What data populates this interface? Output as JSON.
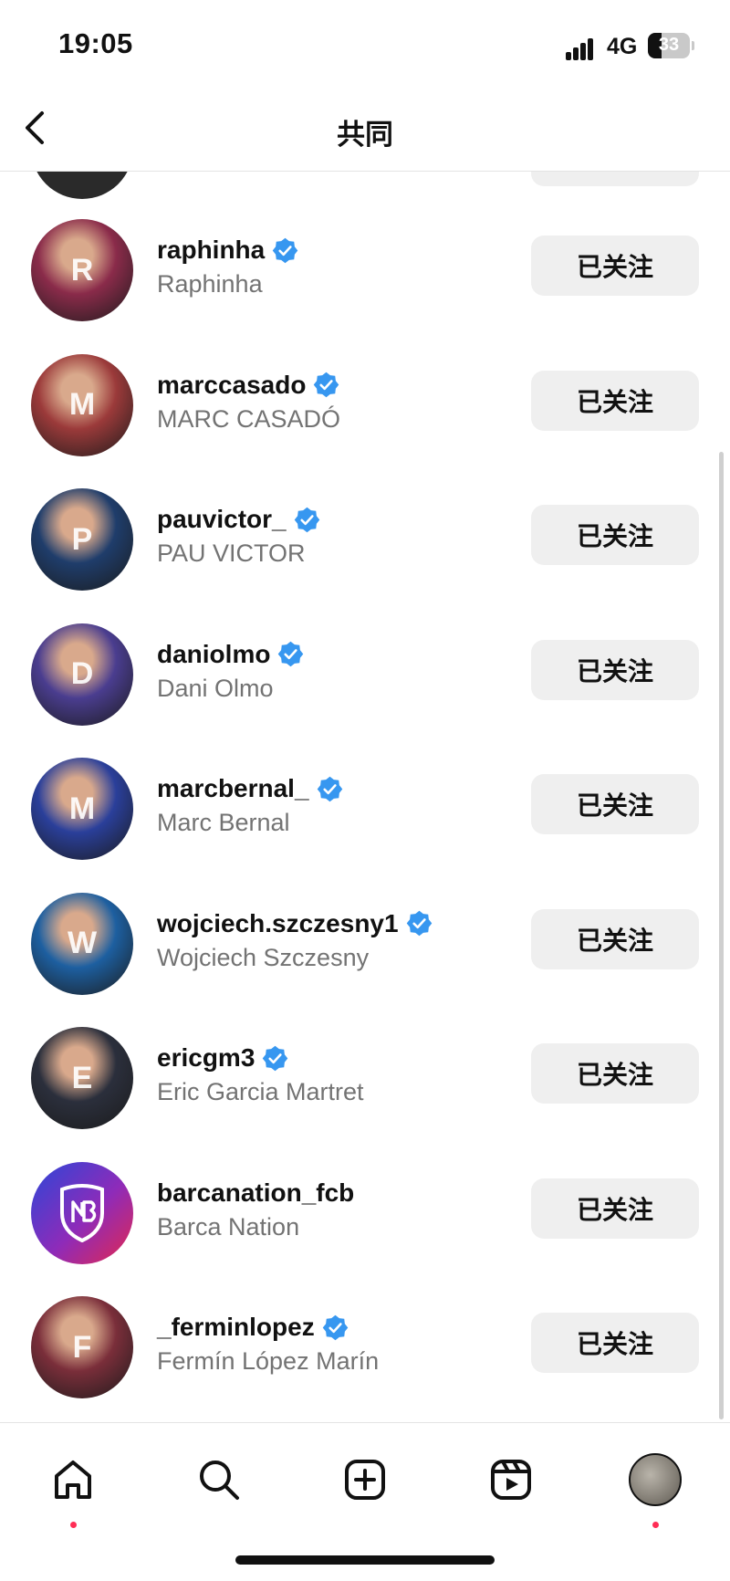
{
  "status_bar": {
    "time": "19:05",
    "network": "4G",
    "battery": "33",
    "battery_level": 0.33
  },
  "header": {
    "title": "共同"
  },
  "follow_label": "已关注",
  "users": [
    {
      "username": "raphinha",
      "full_name": "Raphinha",
      "verified": true,
      "avatar_color": "#8a2b4a",
      "initial": "R"
    },
    {
      "username": "marccasado",
      "full_name": "MARC CASADÓ",
      "verified": true,
      "avatar_color": "#9b3a3a",
      "initial": "M"
    },
    {
      "username": "pauvictor_",
      "full_name": "PAU VICTOR",
      "verified": true,
      "avatar_color": "#1f3d6b",
      "initial": "P"
    },
    {
      "username": "daniolmo",
      "full_name": "Dani Olmo",
      "verified": true,
      "avatar_color": "#4a3d8f",
      "initial": "D"
    },
    {
      "username": "marcbernal_",
      "full_name": "Marc Bernal",
      "verified": true,
      "avatar_color": "#2a3f9a",
      "initial": "M"
    },
    {
      "username": "wojciech.szczesny1",
      "full_name": "Wojciech Szczesny",
      "verified": true,
      "avatar_color": "#1d5fa0",
      "initial": "W"
    },
    {
      "username": "ericgm3",
      "full_name": "Eric Garcia Martret",
      "verified": true,
      "avatar_color": "#2b2f3c",
      "initial": "E"
    },
    {
      "username": "barcanation_fcb",
      "full_name": "Barca Nation",
      "verified": false,
      "avatar_color": "#5a34c7",
      "initial": ""
    },
    {
      "username": "_ferminlopez",
      "full_name": "Fermín López Marín",
      "verified": true,
      "avatar_color": "#7a2e3a",
      "initial": "F"
    }
  ],
  "tab_bar": {
    "items": [
      {
        "name": "home-icon",
        "notification_dot": true
      },
      {
        "name": "search-icon",
        "notification_dot": false
      },
      {
        "name": "create-icon",
        "notification_dot": false
      },
      {
        "name": "reels-icon",
        "notification_dot": false
      },
      {
        "name": "profile-avatar",
        "notification_dot": true
      }
    ]
  },
  "colors": {
    "verified": "#3797f0",
    "button_bg": "#efefef",
    "secondary_text": "#737373",
    "notification_dot": "#ff2d55"
  }
}
